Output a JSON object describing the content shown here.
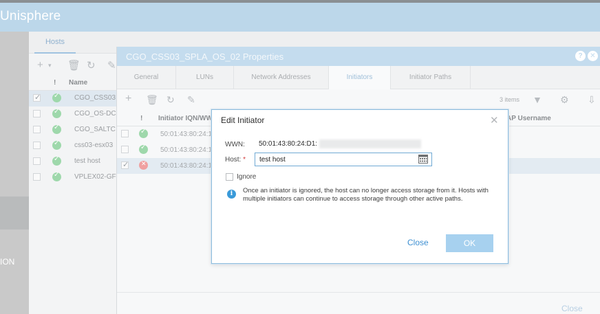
{
  "app": {
    "title": "Unisphere"
  },
  "sidebar": {
    "partial_label": "ION"
  },
  "hosts_panel": {
    "tab": "Hosts",
    "columns": {
      "status": "!",
      "name": "Name"
    },
    "rows": [
      {
        "name": "CGO_CSS03",
        "status": "ok",
        "checked": true
      },
      {
        "name": "CGO_OS-DC",
        "status": "ok",
        "checked": false
      },
      {
        "name": "CGO_SALTC",
        "status": "ok",
        "checked": false
      },
      {
        "name": "css03-esx03",
        "status": "ok",
        "checked": false
      },
      {
        "name": "test host",
        "status": "ok",
        "checked": false
      },
      {
        "name": "VPLEX02-GF",
        "status": "ok",
        "checked": false
      }
    ]
  },
  "properties_dialog": {
    "title": "CGO_CSS03_SPLA_OS_02 Properties",
    "tabs": [
      "General",
      "LUNs",
      "Network Addresses",
      "Initiators",
      "Initiator Paths"
    ],
    "active_tab": "Initiators",
    "items_count": "3 items",
    "columns": {
      "status": "!",
      "iqn": "Initiator IQN/WW",
      "chap": "AP Username"
    },
    "rows": [
      {
        "iqn": "50:01:43:80:24:1",
        "status": "ok"
      },
      {
        "iqn": "50:01:43:80:24:1",
        "status": "ok"
      },
      {
        "iqn": "50:01:43:80:24:1",
        "status": "error"
      }
    ],
    "close_label": "Close"
  },
  "edit_initiator": {
    "title": "Edit Initiator",
    "wwn_label": "WWN:",
    "wwn_value": "50:01:43:80:24:D1:",
    "host_label": "Host:",
    "required_mark": "*",
    "host_value": "test host",
    "ignore_label": "Ignore",
    "info_text": "Once an initiator is ignored, the host can no longer access storage from it. Hosts with multiple initiators can continue to access storage through other active paths.",
    "close_label": "Close",
    "ok_label": "OK"
  }
}
